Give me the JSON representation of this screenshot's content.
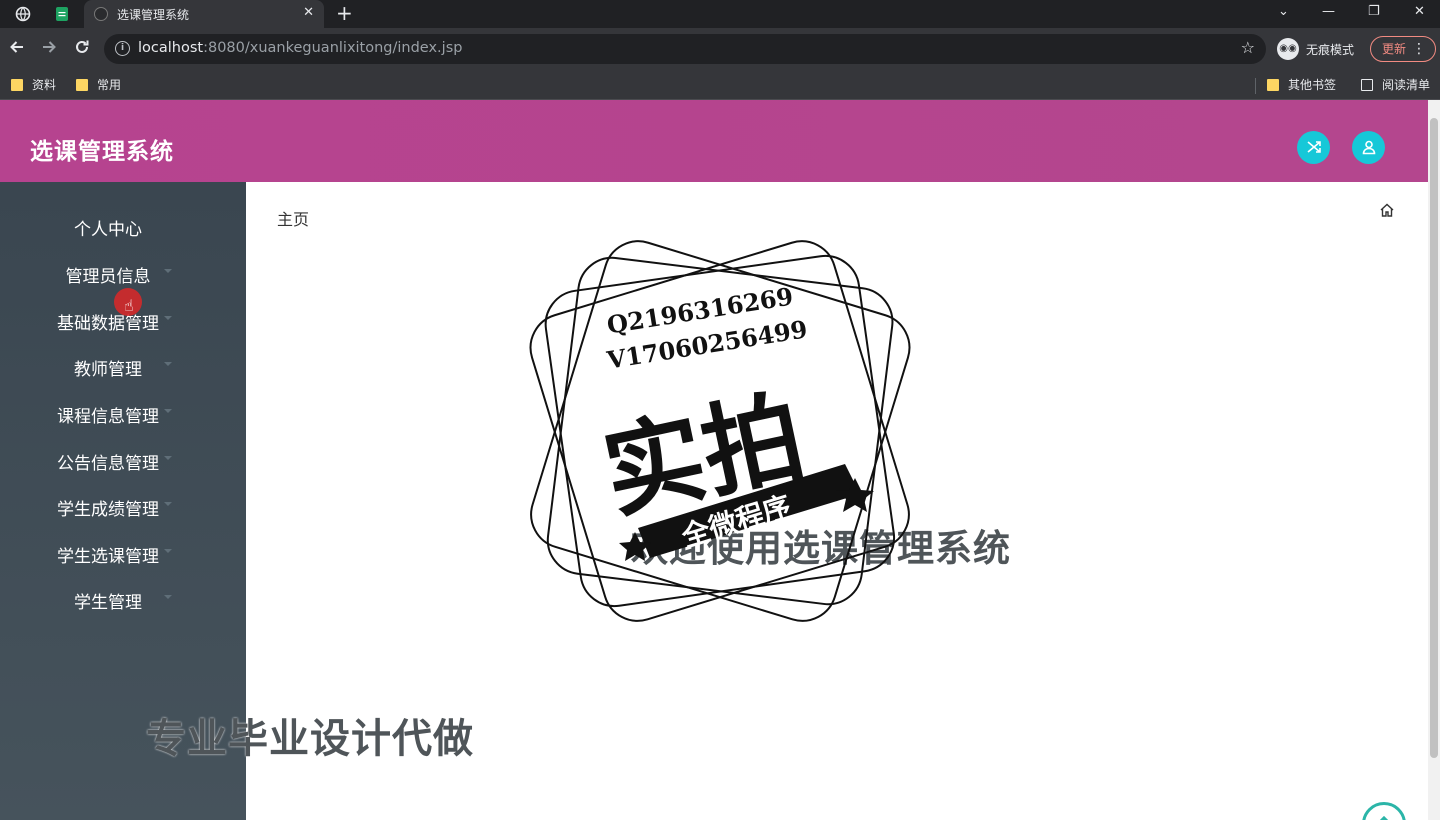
{
  "browser": {
    "tab_title": "选课管理系统",
    "url_host": "localhost",
    "url_rest": ":8080/xuankeguanlixitong/index.jsp",
    "incognito_label": "无痕模式",
    "update_label": "更新",
    "bookmarks": [
      "资料",
      "常用"
    ],
    "other_bookmarks": "其他书签",
    "reading_list": "阅读清单"
  },
  "app": {
    "title": "选课管理系统"
  },
  "sidebar": {
    "items": [
      {
        "label": "个人中心"
      },
      {
        "label": "管理员信息"
      },
      {
        "label": "基础数据管理"
      },
      {
        "label": "教师管理"
      },
      {
        "label": "课程信息管理"
      },
      {
        "label": "公告信息管理"
      },
      {
        "label": "学生成绩管理"
      },
      {
        "label": "学生选课管理"
      },
      {
        "label": "学生管理"
      }
    ]
  },
  "content": {
    "breadcrumb": "主页",
    "welcome": "欢迎使用选课管理系统"
  },
  "watermark": {
    "line1": "Q2196316269",
    "line2": "V17060256499",
    "big": "实拍",
    "banner": "全微程序",
    "bottom": "专业毕业设计代做"
  },
  "colors": {
    "header": "#b6438f",
    "sidebar": "#3a4650",
    "accent": "#16c8d8"
  },
  "icons": {
    "fullscreen": "shuffle-icon",
    "user": "user-icon",
    "home": "home-icon"
  }
}
